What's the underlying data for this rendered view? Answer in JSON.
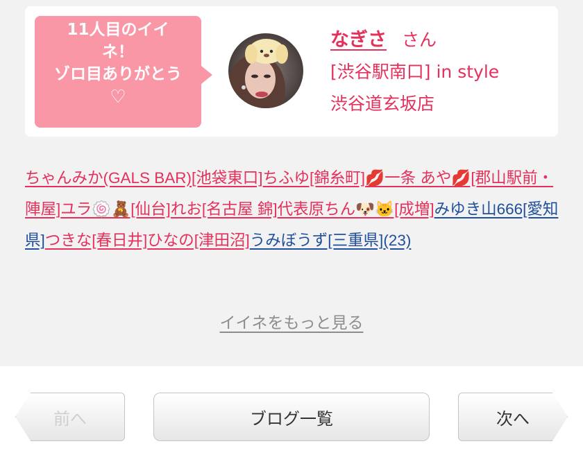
{
  "like_card": {
    "bubble_line1": "11人目のイイ",
    "bubble_line2": "ネ！",
    "bubble_line3": "ゾロ目ありがとう",
    "bubble_heart": "♡",
    "name": "なぎさ",
    "honorific": "さん",
    "shop_line1": "[渋谷駅南口] in style",
    "shop_line2": "渋谷道玄坂店"
  },
  "likers": [
    {
      "text": "ちゃんみか(GALS BAR)",
      "color": "pink"
    },
    {
      "text": "[池袋東口]",
      "color": "pink"
    },
    {
      "text": "ちふゆ[錦糸町]",
      "color": "pink"
    },
    {
      "text": "💋一条 あや💋[郡山駅前・陣屋]",
      "color": "pink"
    },
    {
      "text": "ユラ🍥🧸[仙台]",
      "color": "pink"
    },
    {
      "text": "れお[名古屋 錦]",
      "color": "pink"
    },
    {
      "text": "代表原ちん🐶🐱[成増]",
      "color": "pink"
    },
    {
      "text": "みゆき山666[愛知県]",
      "color": "blue"
    },
    {
      "text": "つきな[春日井]",
      "color": "pink"
    },
    {
      "text": "ひなの[津田沼]",
      "color": "pink"
    },
    {
      "text": "うみぼうず[三重県]",
      "color": "blue"
    },
    {
      "text": "(23)",
      "color": "blue"
    }
  ],
  "more_link": "イイネをもっと見る",
  "nav": {
    "prev": "前へ",
    "list": "ブログ一覧",
    "next": "次へ"
  }
}
